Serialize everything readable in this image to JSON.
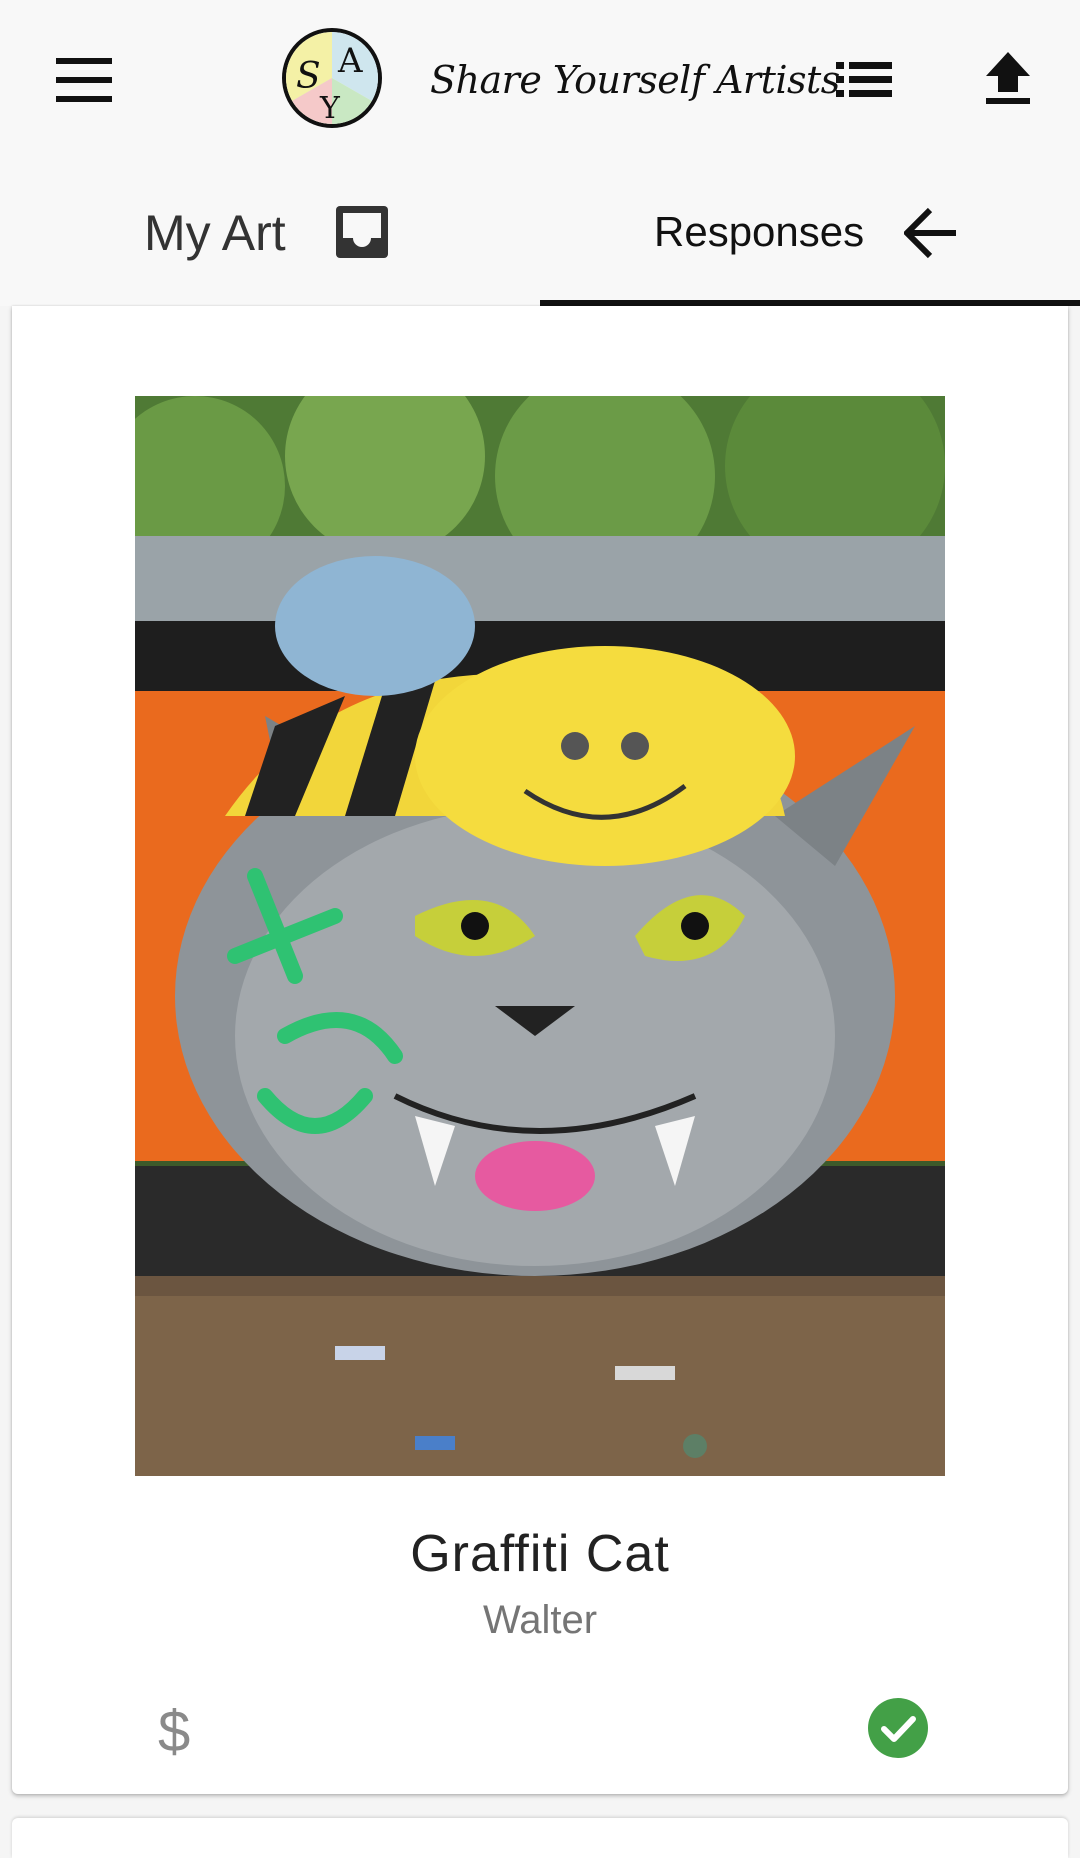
{
  "app": {
    "title": "Share Yourself Artists"
  },
  "header": {
    "menu_icon": "hamburger-menu-icon",
    "logo_letters": "SYA",
    "list_icon": "list-icon",
    "upload_icon": "upload-icon"
  },
  "tabs": [
    {
      "label": "My Art",
      "icon": "inbox-icon",
      "selected": false
    },
    {
      "label": "Responses",
      "icon": "arrow-back-icon",
      "selected": true
    }
  ],
  "card": {
    "title": "Graffiti Cat",
    "artist": "Walter",
    "price_symbol": "$",
    "status_icon": "check-circle-icon",
    "status_color": "#43a047"
  },
  "colors": {
    "background": "#f5f5f5",
    "text_primary": "#111111",
    "text_secondary": "#757575",
    "accent_indicator": "#111111",
    "success": "#43a047"
  }
}
